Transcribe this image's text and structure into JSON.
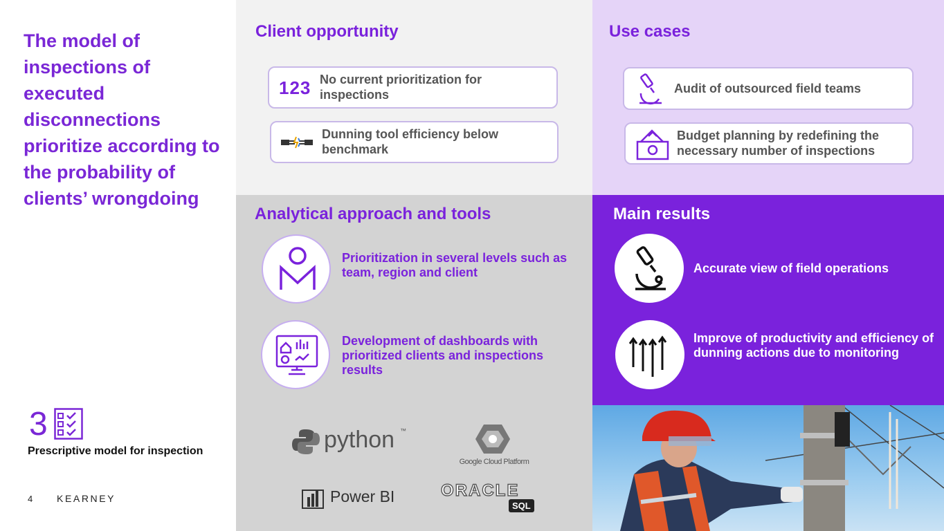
{
  "title": "The model of inspections of executed disconnections prioritize according to the probability of clients’ wrongdoing",
  "model": {
    "number": "3",
    "label": "Prescriptive model for inspection"
  },
  "footer": {
    "page": "4",
    "brand": "KEARNEY"
  },
  "client_opportunity": {
    "title": "Client opportunity",
    "items": [
      {
        "icon": "numbers-123-icon",
        "icon_text": "123",
        "text": "No current prioritization for inspections"
      },
      {
        "icon": "connection-plug-icon",
        "text": "Dunning tool efficiency below benchmark"
      }
    ]
  },
  "use_cases": {
    "title": "Use cases",
    "items": [
      {
        "icon": "microscope-icon",
        "text": "Audit of outsourced field teams"
      },
      {
        "icon": "money-budget-icon",
        "text": "Budget planning by redefining the necessary number of inspections"
      }
    ]
  },
  "approach": {
    "title": "Analytical approach and tools",
    "items": [
      {
        "icon": "user-levels-icon",
        "text": "Prioritization in several levels such as team, region and client"
      },
      {
        "icon": "dashboard-monitor-icon",
        "text": "Development of dashboards with prioritized clients and inspections results"
      }
    ],
    "tools": {
      "python": "python",
      "python_tm": "™",
      "gcp": "Google Cloud Platform",
      "powerbi": "Power BI",
      "oracle": "ORACLE",
      "sql": "SQL"
    }
  },
  "results": {
    "title": "Main results",
    "items": [
      {
        "icon": "microscope-icon",
        "text": "Accurate view of field operations"
      },
      {
        "icon": "arrows-up-icon",
        "text": "Improve of productivity and efficiency of dunning actions due to monitoring"
      }
    ]
  },
  "colors": {
    "accent": "#7a22dc",
    "lavender": "#e5d4f8",
    "light_gray": "#f2f2f2",
    "gray": "#d3d3d3"
  }
}
